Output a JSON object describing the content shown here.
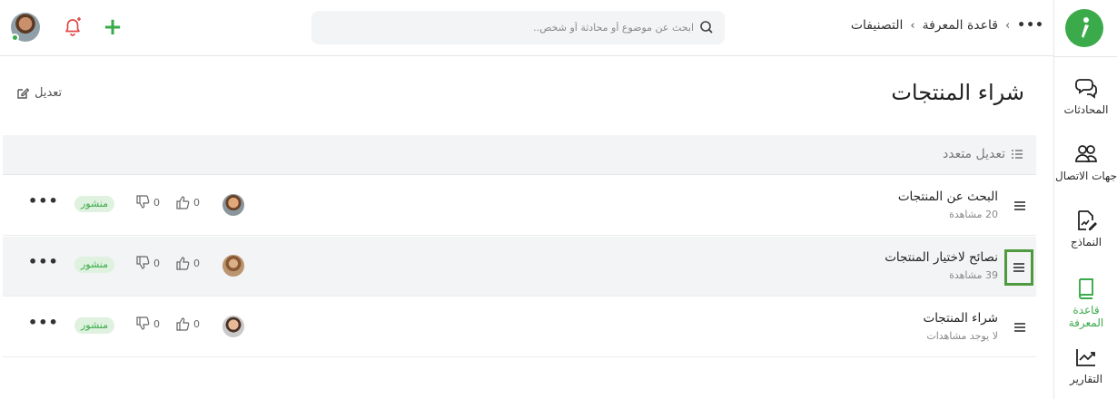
{
  "header": {
    "breadcrumb": {
      "more": "•••",
      "items": [
        "قاعدة المعرفة",
        "التصنيفات"
      ],
      "separator": "›"
    },
    "search": {
      "placeholder": "ابحث عن موضوع أو محادثة أو شخص..",
      "value": ""
    },
    "actions": {
      "plus": "+"
    }
  },
  "sidebar": {
    "items": [
      {
        "label": "المحادثات",
        "icon": "chat-bubbles-icon"
      },
      {
        "label": "جهات الاتصال",
        "icon": "contacts-icon"
      },
      {
        "label": "النماذج",
        "icon": "form-edit-icon"
      },
      {
        "label": "قاعدة المعرفة",
        "icon": "book-icon",
        "active": true
      },
      {
        "label": "التقارير",
        "icon": "chart-line-icon"
      }
    ]
  },
  "main": {
    "title": "شراء المنتجات",
    "edit_label": "تعديل",
    "bulk_edit_label": "تعديل متعدد",
    "rows": [
      {
        "name": "البحث عن المنتجات",
        "views": "20 مشاهدة",
        "likes": "0",
        "dislikes": "0",
        "status": "منشور",
        "more": "•••"
      },
      {
        "name": "نصائح لاختيار المنتجات",
        "views": "39 مشاهدة",
        "likes": "0",
        "dislikes": "0",
        "status": "منشور",
        "more": "•••"
      },
      {
        "name": "شراء المنتجات",
        "views": "لا يوجد مشاهدات",
        "likes": "0",
        "dislikes": "0",
        "status": "منشور",
        "more": "•••"
      }
    ]
  },
  "colors": {
    "accent": "#3aaa4a",
    "bell": "#e24a4a",
    "selection": "#4f9a3e",
    "row_highlight": "#f3f4f6"
  }
}
